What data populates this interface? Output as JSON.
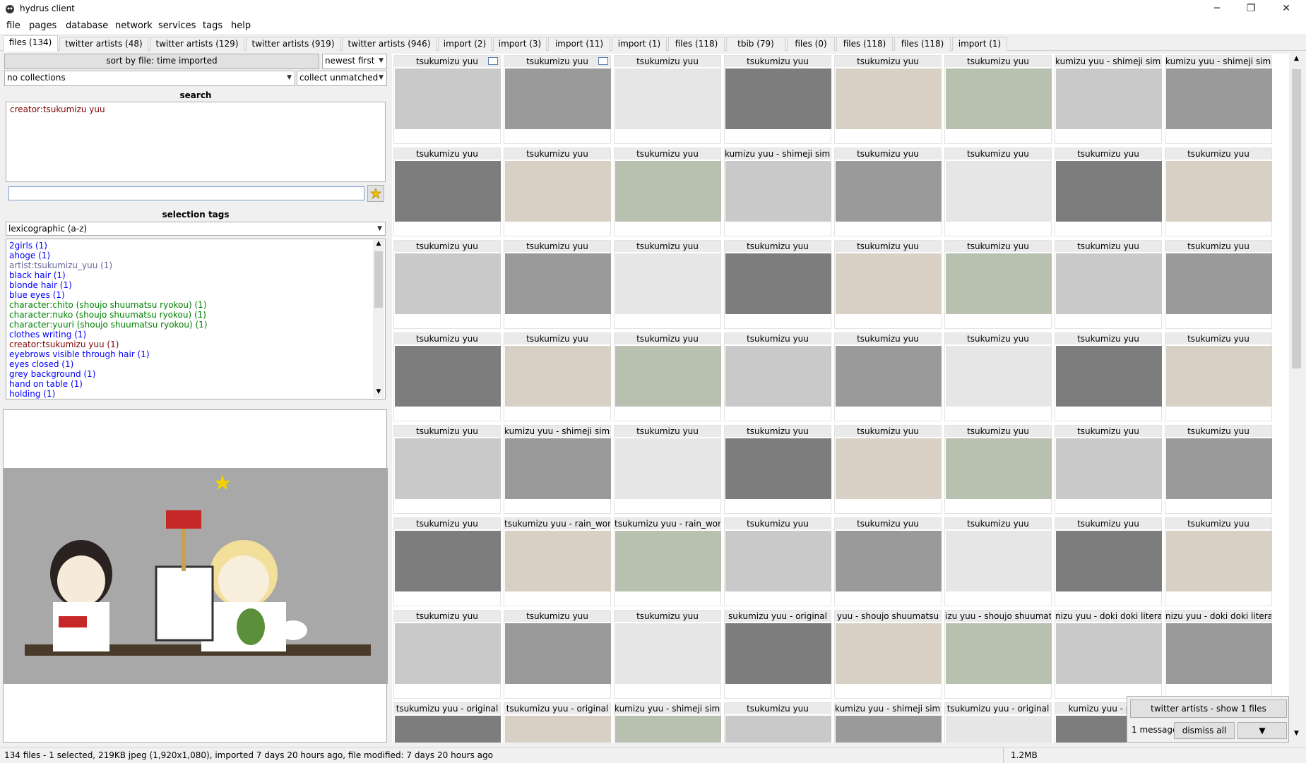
{
  "window": {
    "title": "hydrus client",
    "minimize": "─",
    "maximize": "❐",
    "close": "✕"
  },
  "menu": [
    "file",
    "pages",
    "database",
    "network",
    "services",
    "tags",
    "help"
  ],
  "tabs": [
    "files (134)",
    "twitter artists (48)",
    "twitter artists (129)",
    "twitter artists (919)",
    "twitter artists (946)",
    "import (2)",
    "import (3)",
    "import (11)",
    "import (1)",
    "files (118)",
    "tbib (79)",
    "files (0)",
    "files (118)",
    "files (118)",
    "import (1)"
  ],
  "sort": {
    "by": "sort by file: time imported",
    "order": "newest first",
    "collections": "no collections",
    "collect": "collect unmatched"
  },
  "search": {
    "heading": "search",
    "predicates": [
      "creator:tsukumizu yuu"
    ],
    "input_value": ""
  },
  "selection_tags": {
    "heading": "selection tags",
    "sort": "lexicographic (a-z)",
    "items": [
      {
        "text": "2girls (1)",
        "kind": "blue"
      },
      {
        "text": "ahoge (1)",
        "kind": "blue"
      },
      {
        "text": "artist:tsukumizu_yuu (1)",
        "kind": "grey"
      },
      {
        "text": "black hair (1)",
        "kind": "blue"
      },
      {
        "text": "blonde hair (1)",
        "kind": "blue"
      },
      {
        "text": "blue eyes (1)",
        "kind": "blue"
      },
      {
        "text": "character:chito (shoujo shuumatsu ryokou) (1)",
        "kind": "green"
      },
      {
        "text": "character:nuko (shoujo shuumatsu ryokou) (1)",
        "kind": "green"
      },
      {
        "text": "character:yuuri (shoujo shuumatsu ryokou) (1)",
        "kind": "green"
      },
      {
        "text": "clothes writing (1)",
        "kind": "blue"
      },
      {
        "text": "creator:tsukumizu yuu (1)",
        "kind": "red"
      },
      {
        "text": "eyebrows visible through hair (1)",
        "kind": "blue"
      },
      {
        "text": "eyes closed (1)",
        "kind": "blue"
      },
      {
        "text": "grey background (1)",
        "kind": "blue"
      },
      {
        "text": "hand on table (1)",
        "kind": "blue"
      },
      {
        "text": "holding (1)",
        "kind": "blue"
      }
    ]
  },
  "thumbnails": [
    [
      "tsukumizu yuu",
      "tsukumizu yuu",
      "tsukumizu yuu",
      "tsukumizu yuu",
      "tsukumizu yuu",
      "tsukumizu yuu",
      "kumizu yuu - shimeji simulat",
      "kumizu yuu - shimeji simulat"
    ],
    [
      "tsukumizu yuu",
      "tsukumizu yuu",
      "tsukumizu yuu",
      "kumizu yuu - shimeji simulat",
      "tsukumizu yuu",
      "tsukumizu yuu",
      "tsukumizu yuu",
      "tsukumizu yuu"
    ],
    [
      "tsukumizu yuu",
      "tsukumizu yuu",
      "tsukumizu yuu",
      "tsukumizu yuu",
      "tsukumizu yuu",
      "tsukumizu yuu",
      "tsukumizu yuu",
      "tsukumizu yuu"
    ],
    [
      "tsukumizu yuu",
      "tsukumizu yuu",
      "tsukumizu yuu",
      "tsukumizu yuu",
      "tsukumizu yuu",
      "tsukumizu yuu",
      "tsukumizu yuu",
      "tsukumizu yuu"
    ],
    [
      "tsukumizu yuu",
      "kumizu yuu - shimeji simulat",
      "tsukumizu yuu",
      "tsukumizu yuu",
      "tsukumizu yuu",
      "tsukumizu yuu",
      "tsukumizu yuu",
      "tsukumizu yuu"
    ],
    [
      "tsukumizu yuu",
      "tsukumizu yuu - rain_world",
      "tsukumizu yuu - rain_world",
      "tsukumizu yuu",
      "tsukumizu yuu",
      "tsukumizu yuu",
      "tsukumizu yuu",
      "tsukumizu yuu"
    ],
    [
      "tsukumizu yuu",
      "tsukumizu yuu",
      "tsukumizu yuu",
      "sukumizu yuu - original",
      "yuu - shoujo shuumatsu",
      "izu yuu - shoujo shuumatsu",
      "nizu yuu - doki doki literatur",
      "nizu yuu - doki doki literatur"
    ],
    [
      "tsukumizu yuu - original",
      "tsukumizu yuu - original",
      "kumizu yuu - shimeji simulat",
      "tsukumizu yuu",
      "kumizu yuu - shimeji simulat",
      "tsukumizu yuu - original",
      "kumizu yuu - plays",
      ""
    ]
  ],
  "popup": {
    "show_files": "twitter artists - show 1 files",
    "message_count": "1 message",
    "dismiss": "dismiss all",
    "expand": "▼"
  },
  "status": {
    "text": "134 files - 1 selected, 219KB jpeg (1,920x1,080), imported 7 days 20 hours ago, file modified: 7 days 20 hours ago",
    "memory": "1.2MB"
  },
  "colors": {
    "blue_tag": "#0000ff",
    "grey_tag": "#666699",
    "green_tag": "#008000",
    "red_tag": "#800000"
  }
}
